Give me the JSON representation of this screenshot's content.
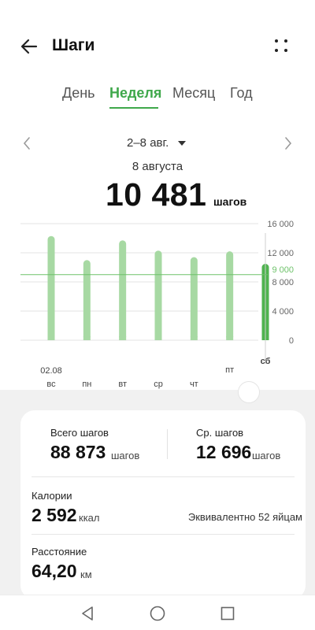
{
  "header": {
    "title": "Шаги",
    "back_icon": "arrow-left-icon",
    "more_icon": "four-dots-icon"
  },
  "tabs": [
    {
      "label": "День",
      "active": false
    },
    {
      "label": "Неделя",
      "active": true
    },
    {
      "label": "Месяц",
      "active": false
    },
    {
      "label": "Год",
      "active": false
    }
  ],
  "period": {
    "label": "2–8 авг.",
    "prev_icon": "chevron-left-icon",
    "next_icon": "chevron-right-icon",
    "dropdown_icon": "caret-down-icon"
  },
  "summary": {
    "date": "8 августа",
    "steps": "10 481",
    "unit": "шагов"
  },
  "chart_data": {
    "type": "bar",
    "categories": [
      "вс",
      "пн",
      "вт",
      "ср",
      "чт",
      "пт",
      "сб"
    ],
    "date_label": "02.08",
    "highlight_labels": [
      "пт",
      "сб"
    ],
    "values": [
      14300,
      11000,
      13700,
      12300,
      11400,
      12200,
      10481
    ],
    "selected_index": 6,
    "goal": 9000,
    "goal_label": "9 000",
    "yticks": [
      0,
      4000,
      8000,
      12000,
      16000
    ],
    "ytick_labels": [
      "0",
      "4 000",
      "8 000",
      "12 000",
      "16 000"
    ],
    "ylim": [
      0,
      16000
    ],
    "colors": {
      "bar": "#a7d9a3",
      "selected": "#4fb34f",
      "goal": "#6ec26a",
      "grid": "#e3e3e3"
    }
  },
  "stats": {
    "total": {
      "label": "Всего шагов",
      "value": "88 873",
      "unit": "шагов"
    },
    "average": {
      "label": "Ср. шагов",
      "value": "12 696",
      "unit": "шагов"
    },
    "calories": {
      "label": "Калории",
      "value": "2 592",
      "unit": "ккал",
      "equivalent": "Эквивалентно 52 яйцам"
    },
    "distance": {
      "label": "Расстояние",
      "value": "64,20",
      "unit": "км"
    }
  },
  "navbar": {
    "back_icon": "triangle-back-icon",
    "home_icon": "circle-home-icon",
    "recent_icon": "square-recent-icon"
  }
}
